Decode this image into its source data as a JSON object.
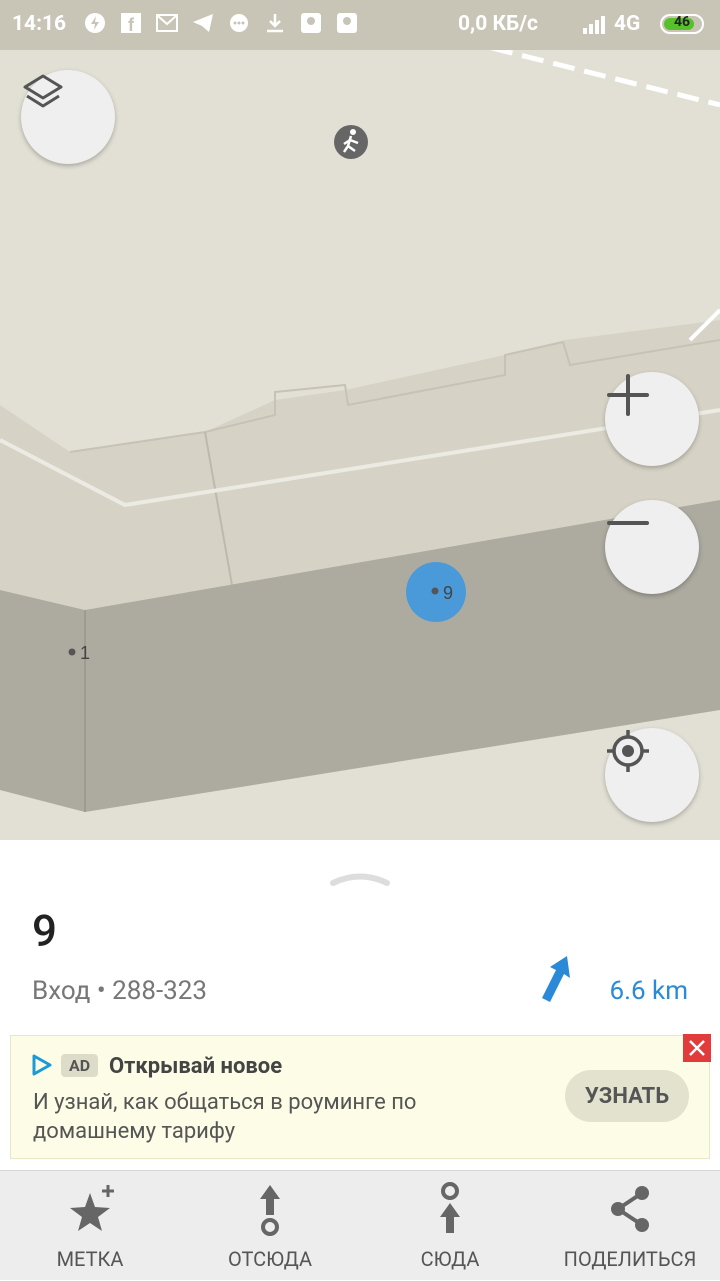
{
  "status_bar": {
    "time": "14:16",
    "network_speed": "0,0 КБ/с",
    "network_type": "4G",
    "battery_level": "46"
  },
  "map": {
    "markers": [
      {
        "label": "9"
      },
      {
        "label": "1"
      }
    ]
  },
  "place": {
    "title": "9",
    "subtitle": "Вход • 288-323",
    "distance": "6.6 km"
  },
  "ad": {
    "badge": "AD",
    "title": "Открывай новое",
    "text": "И узнай, как общаться в роуминге по домашнему тарифу",
    "button": "УЗНАТЬ"
  },
  "bottom_bar": {
    "items": [
      {
        "label": "МЕТКА",
        "icon": "star-plus-icon"
      },
      {
        "label": "ОТСЮДА",
        "icon": "route-from-icon"
      },
      {
        "label": "СЮДА",
        "icon": "route-to-icon"
      },
      {
        "label": "ПОДЕЛИТЬСЯ",
        "icon": "share-icon"
      }
    ]
  },
  "colors": {
    "accent": "#2b8ad8",
    "marker": "#4a9ad9",
    "map_bg": "#e2e0d4"
  }
}
